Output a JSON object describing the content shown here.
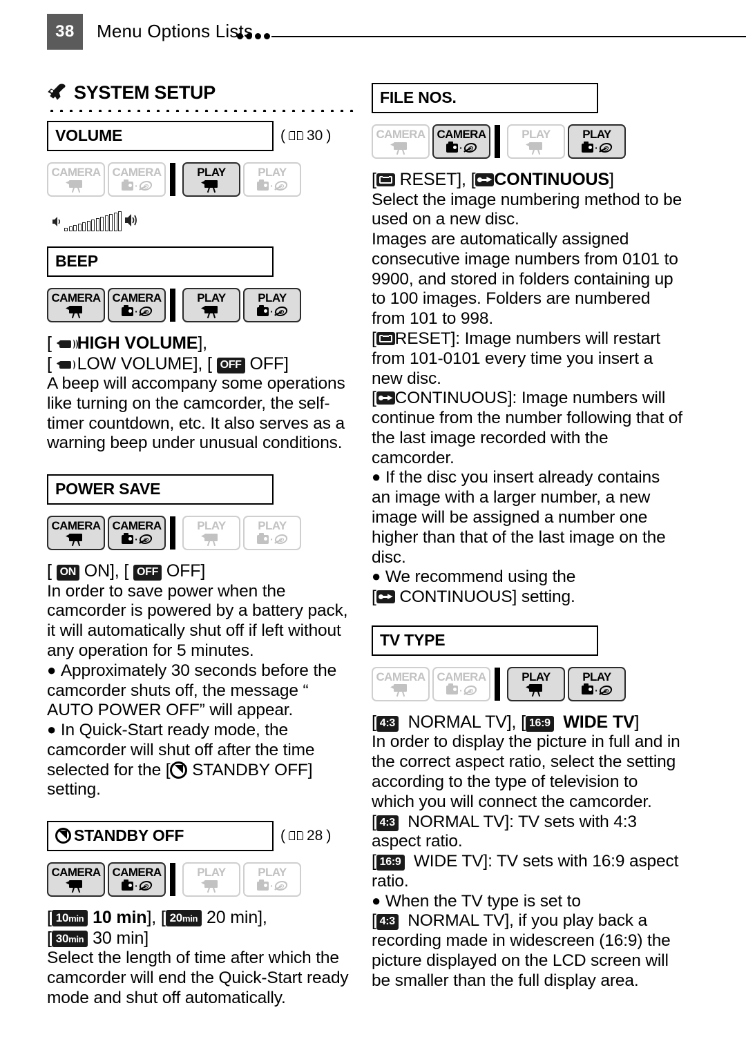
{
  "header": {
    "page_number": "38",
    "title": "Menu Options Lists",
    "dot_count": 4
  },
  "badge_legend": {
    "camera_label": "CAMERA",
    "play_label": "PLAY"
  },
  "left_column": {
    "group_title": "SYSTEM SETUP",
    "group_icon": "wrench-icon",
    "sections": [
      {
        "id": "volume",
        "title": "VOLUME",
        "title_icon": null,
        "page_ref": "30",
        "badges": [
          {
            "label": "CAMERA",
            "glyph": "camcorder",
            "active": false
          },
          {
            "label": "CAMERA",
            "glyph": "photo-disc",
            "active": false
          },
          {
            "label": "PLAY",
            "glyph": "camcorder",
            "active": true
          },
          {
            "label": "PLAY",
            "glyph": "photo-disc",
            "active": false
          }
        ],
        "graphic": "volume-slider",
        "options_line": "",
        "paragraphs": []
      },
      {
        "id": "beep",
        "title": "BEEP",
        "title_icon": null,
        "page_ref": null,
        "badges": [
          {
            "label": "CAMERA",
            "glyph": "camcorder",
            "active": true
          },
          {
            "label": "CAMERA",
            "glyph": "photo-disc",
            "active": true
          },
          {
            "label": "PLAY",
            "glyph": "camcorder",
            "active": true
          },
          {
            "label": "PLAY",
            "glyph": "photo-disc",
            "active": true
          }
        ],
        "option_1": "HIGH VOLUME",
        "option_2": "LOW VOLUME",
        "option_3": "OFF",
        "option_3_pill": "OFF",
        "paragraph": "A beep will accompany some operations like turning on the camcorder, the self-timer countdown, etc. It also serves as a warning beep under unusual conditions."
      },
      {
        "id": "power-save",
        "title": "POWER SAVE",
        "title_icon": null,
        "page_ref": null,
        "badges": [
          {
            "label": "CAMERA",
            "glyph": "camcorder",
            "active": true
          },
          {
            "label": "CAMERA",
            "glyph": "photo-disc",
            "active": true
          },
          {
            "label": "PLAY",
            "glyph": "camcorder",
            "active": false
          },
          {
            "label": "PLAY",
            "glyph": "photo-disc",
            "active": false
          }
        ],
        "option_on_pill": "ON",
        "option_on": "ON",
        "option_off_pill": "OFF",
        "option_off": "OFF",
        "paragraph_1": "In order to save power when the camcorder is powered by a battery pack, it will automatically shut off if left without any operation for 5 minutes.",
        "bullet_1": "Approximately 30 seconds before the camcorder shuts off, the message “    AUTO POWER OFF” will appear.",
        "bullet_2_a": "In Quick-Start ready mode, the camcorder will shut off after the time selected for the [",
        "bullet_2_b": "STANDBY OFF] setting."
      },
      {
        "id": "standby-off",
        "title": "STANDBY OFF",
        "title_icon": "standby-icon",
        "page_ref": "28",
        "badges": [
          {
            "label": "CAMERA",
            "glyph": "camcorder",
            "active": true
          },
          {
            "label": "CAMERA",
            "glyph": "photo-disc",
            "active": true
          },
          {
            "label": "PLAY",
            "glyph": "camcorder",
            "active": false
          },
          {
            "label": "PLAY",
            "glyph": "photo-disc",
            "active": false
          }
        ],
        "opt_10_pill_num": "10",
        "opt_10_pill_unit": "min",
        "opt_10_label": "10 min",
        "opt_20_pill_num": "20",
        "opt_20_pill_unit": "min",
        "opt_20_label": "20 min",
        "opt_30_pill_num": "30",
        "opt_30_pill_unit": "min",
        "opt_30_label": "30 min",
        "paragraph": "Select the length of time after which the camcorder will end the Quick-Start ready mode and shut off automatically."
      }
    ]
  },
  "right_column": {
    "sections": [
      {
        "id": "file-nos",
        "title": "FILE NOS.",
        "page_ref": null,
        "badges": [
          {
            "label": "CAMERA",
            "glyph": "camcorder",
            "active": false
          },
          {
            "label": "CAMERA",
            "glyph": "photo-disc",
            "active": true
          },
          {
            "label": "PLAY",
            "glyph": "camcorder",
            "active": false
          },
          {
            "label": "PLAY",
            "glyph": "photo-disc",
            "active": true
          }
        ],
        "option_reset": "RESET",
        "option_continuous": "CONTINUOUS",
        "paragraph_1": "Select the image numbering method to be used on a new disc.",
        "paragraph_2": "Images are automatically assigned consecutive image numbers from 0101 to 9900, and stored in folders containing up to 100 images. Folders are numbered from 101 to 998.",
        "reset_desc_label": "RESET",
        "reset_desc": "]: Image numbers will restart from 101-0101 every time you insert a new disc.",
        "cont_desc_label": "CONTINUOUS",
        "cont_desc": "]: Image numbers will continue from the number following that of the last image recorded with the camcorder.",
        "bullet_1": "If the disc you insert already contains an image with a larger number, a new image will be assigned a number one higher than that of the last image on the disc.",
        "bullet_2_a": "We recommend using the",
        "bullet_2_b": "CONTINUOUS] setting."
      },
      {
        "id": "tv-type",
        "title": "TV TYPE",
        "page_ref": null,
        "badges": [
          {
            "label": "CAMERA",
            "glyph": "camcorder",
            "active": false
          },
          {
            "label": "CAMERA",
            "glyph": "photo-disc",
            "active": false
          },
          {
            "label": "PLAY",
            "glyph": "camcorder",
            "active": true
          },
          {
            "label": "PLAY",
            "glyph": "photo-disc",
            "active": true
          }
        ],
        "option_normal_pill": "4:3",
        "option_normal": "NORMAL TV",
        "option_wide_pill": "16:9",
        "option_wide": "WIDE TV",
        "paragraph_1": "In order to display the picture in full and in the correct aspect ratio, select the setting according to the type of television to which you will connect the camcorder.",
        "normal_desc": "NORMAL TV]: TV sets with 4:3 aspect ratio.",
        "wide_desc": "WIDE TV]: TV sets with 16:9 aspect ratio.",
        "bullet_1_a": "When the TV type is set to",
        "bullet_1_b": "NORMAL TV], if you play back a recording made in widescreen (16:9) the picture displayed on the LCD screen will be smaller than the full display area."
      }
    ]
  },
  "colors": {
    "page_badge_bg": "#5b5b5b",
    "active_badge_bg": "#dcdcdc",
    "inactive_badge_fg": "#c2c2c2",
    "pill_bg": "#1a1a1a"
  }
}
